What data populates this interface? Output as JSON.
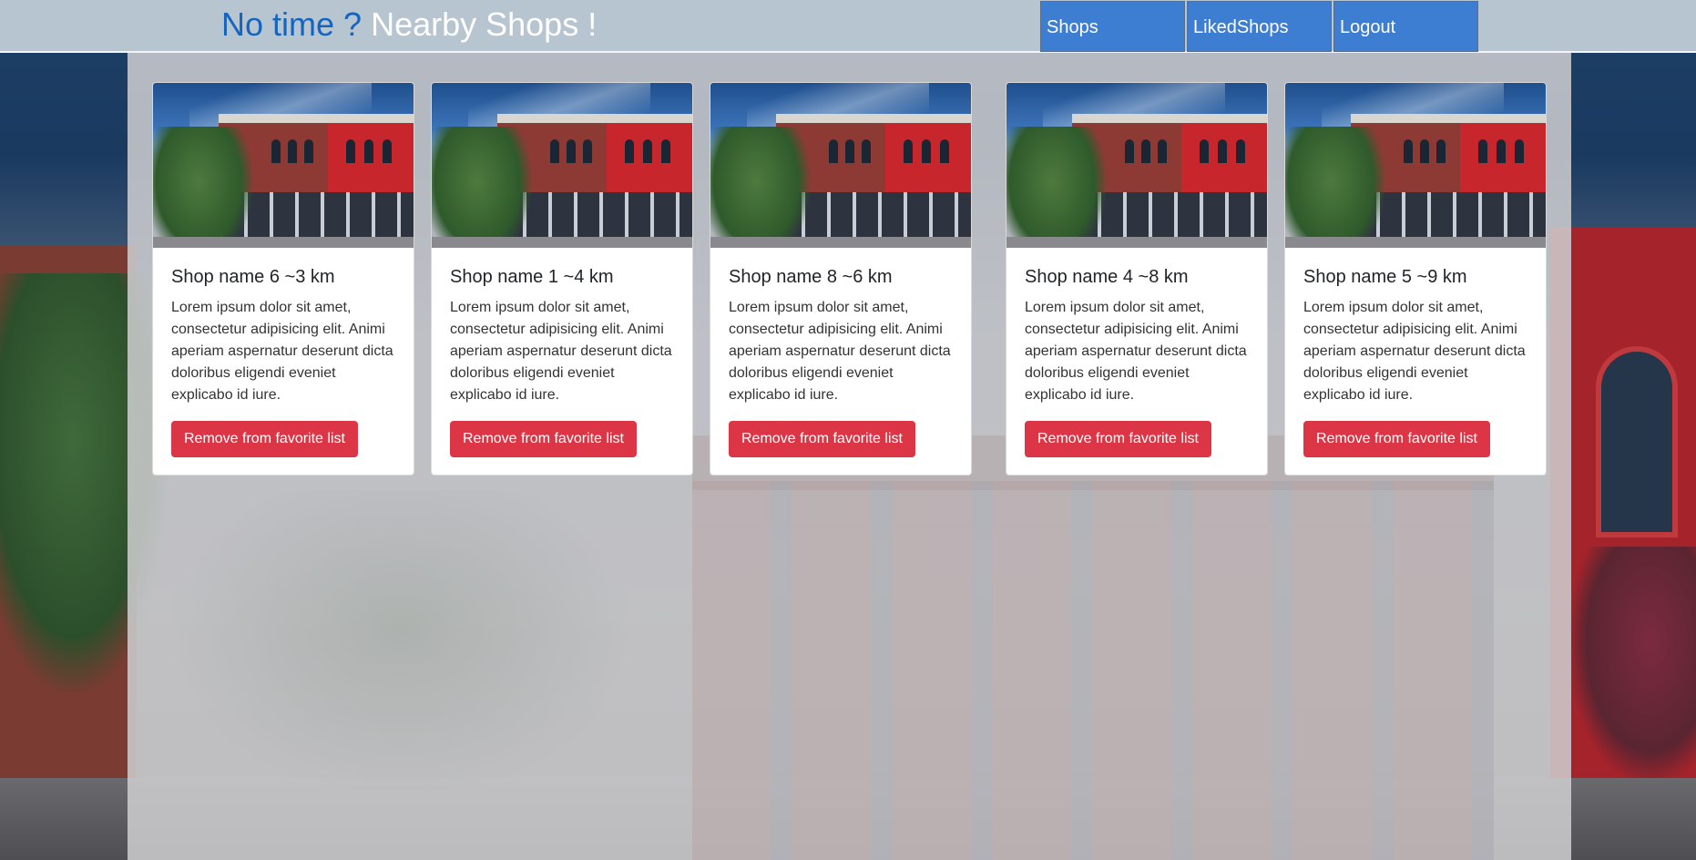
{
  "header": {
    "brand_part1": "No time ?",
    "brand_part2": "Nearby Shops !",
    "nav": [
      {
        "label": "Shops"
      },
      {
        "label": "LikedShops"
      },
      {
        "label": "Logout"
      }
    ]
  },
  "cards": [
    {
      "title": "Shop name 6 ~3 km",
      "text": "Lorem ipsum dolor sit amet, consectetur adipisicing elit. Animi aperiam aspernatur deserunt dicta doloribus eligendi eveniet explicabo id iure.",
      "button": "Remove from favorite list"
    },
    {
      "title": "Shop name 1 ~4 km",
      "text": "Lorem ipsum dolor sit amet, consectetur adipisicing elit. Animi aperiam aspernatur deserunt dicta doloribus eligendi eveniet explicabo id iure.",
      "button": "Remove from favorite list"
    },
    {
      "title": "Shop name 8 ~6 km",
      "text": "Lorem ipsum dolor sit amet, consectetur adipisicing elit. Animi aperiam aspernatur deserunt dicta doloribus eligendi eveniet explicabo id iure.",
      "button": "Remove from favorite list"
    },
    {
      "title": "Shop name 4 ~8 km",
      "text": "Lorem ipsum dolor sit amet, consectetur adipisicing elit. Animi aperiam aspernatur deserunt dicta doloribus eligendi eveniet explicabo id iure.",
      "button": "Remove from favorite list"
    },
    {
      "title": "Shop name 5 ~9 km",
      "text": "Lorem ipsum dolor sit amet, consectetur adipisicing elit. Animi aperiam aspernatur deserunt dicta doloribus eligendi eveniet explicabo id iure.",
      "button": "Remove from favorite list"
    }
  ],
  "colors": {
    "brand_blue": "#1565c0",
    "nav_button": "#3e7ed2",
    "header_bg": "#b7c5d1",
    "remove_button": "#dc3545"
  }
}
